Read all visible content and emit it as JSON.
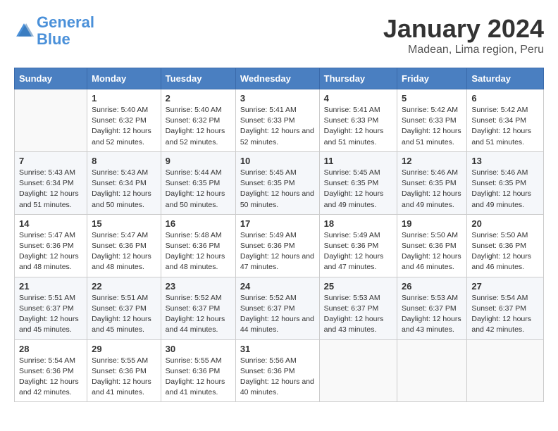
{
  "header": {
    "logo_line1": "General",
    "logo_line2": "Blue",
    "month": "January 2024",
    "location": "Madean, Lima region, Peru"
  },
  "columns": [
    "Sunday",
    "Monday",
    "Tuesday",
    "Wednesday",
    "Thursday",
    "Friday",
    "Saturday"
  ],
  "weeks": [
    [
      {
        "day": "",
        "sunrise": "",
        "sunset": "",
        "daylight": ""
      },
      {
        "day": "1",
        "sunrise": "Sunrise: 5:40 AM",
        "sunset": "Sunset: 6:32 PM",
        "daylight": "Daylight: 12 hours and 52 minutes."
      },
      {
        "day": "2",
        "sunrise": "Sunrise: 5:40 AM",
        "sunset": "Sunset: 6:32 PM",
        "daylight": "Daylight: 12 hours and 52 minutes."
      },
      {
        "day": "3",
        "sunrise": "Sunrise: 5:41 AM",
        "sunset": "Sunset: 6:33 PM",
        "daylight": "Daylight: 12 hours and 52 minutes."
      },
      {
        "day": "4",
        "sunrise": "Sunrise: 5:41 AM",
        "sunset": "Sunset: 6:33 PM",
        "daylight": "Daylight: 12 hours and 51 minutes."
      },
      {
        "day": "5",
        "sunrise": "Sunrise: 5:42 AM",
        "sunset": "Sunset: 6:33 PM",
        "daylight": "Daylight: 12 hours and 51 minutes."
      },
      {
        "day": "6",
        "sunrise": "Sunrise: 5:42 AM",
        "sunset": "Sunset: 6:34 PM",
        "daylight": "Daylight: 12 hours and 51 minutes."
      }
    ],
    [
      {
        "day": "7",
        "sunrise": "Sunrise: 5:43 AM",
        "sunset": "Sunset: 6:34 PM",
        "daylight": "Daylight: 12 hours and 51 minutes."
      },
      {
        "day": "8",
        "sunrise": "Sunrise: 5:43 AM",
        "sunset": "Sunset: 6:34 PM",
        "daylight": "Daylight: 12 hours and 50 minutes."
      },
      {
        "day": "9",
        "sunrise": "Sunrise: 5:44 AM",
        "sunset": "Sunset: 6:35 PM",
        "daylight": "Daylight: 12 hours and 50 minutes."
      },
      {
        "day": "10",
        "sunrise": "Sunrise: 5:45 AM",
        "sunset": "Sunset: 6:35 PM",
        "daylight": "Daylight: 12 hours and 50 minutes."
      },
      {
        "day": "11",
        "sunrise": "Sunrise: 5:45 AM",
        "sunset": "Sunset: 6:35 PM",
        "daylight": "Daylight: 12 hours and 49 minutes."
      },
      {
        "day": "12",
        "sunrise": "Sunrise: 5:46 AM",
        "sunset": "Sunset: 6:35 PM",
        "daylight": "Daylight: 12 hours and 49 minutes."
      },
      {
        "day": "13",
        "sunrise": "Sunrise: 5:46 AM",
        "sunset": "Sunset: 6:35 PM",
        "daylight": "Daylight: 12 hours and 49 minutes."
      }
    ],
    [
      {
        "day": "14",
        "sunrise": "Sunrise: 5:47 AM",
        "sunset": "Sunset: 6:36 PM",
        "daylight": "Daylight: 12 hours and 48 minutes."
      },
      {
        "day": "15",
        "sunrise": "Sunrise: 5:47 AM",
        "sunset": "Sunset: 6:36 PM",
        "daylight": "Daylight: 12 hours and 48 minutes."
      },
      {
        "day": "16",
        "sunrise": "Sunrise: 5:48 AM",
        "sunset": "Sunset: 6:36 PM",
        "daylight": "Daylight: 12 hours and 48 minutes."
      },
      {
        "day": "17",
        "sunrise": "Sunrise: 5:49 AM",
        "sunset": "Sunset: 6:36 PM",
        "daylight": "Daylight: 12 hours and 47 minutes."
      },
      {
        "day": "18",
        "sunrise": "Sunrise: 5:49 AM",
        "sunset": "Sunset: 6:36 PM",
        "daylight": "Daylight: 12 hours and 47 minutes."
      },
      {
        "day": "19",
        "sunrise": "Sunrise: 5:50 AM",
        "sunset": "Sunset: 6:36 PM",
        "daylight": "Daylight: 12 hours and 46 minutes."
      },
      {
        "day": "20",
        "sunrise": "Sunrise: 5:50 AM",
        "sunset": "Sunset: 6:36 PM",
        "daylight": "Daylight: 12 hours and 46 minutes."
      }
    ],
    [
      {
        "day": "21",
        "sunrise": "Sunrise: 5:51 AM",
        "sunset": "Sunset: 6:37 PM",
        "daylight": "Daylight: 12 hours and 45 minutes."
      },
      {
        "day": "22",
        "sunrise": "Sunrise: 5:51 AM",
        "sunset": "Sunset: 6:37 PM",
        "daylight": "Daylight: 12 hours and 45 minutes."
      },
      {
        "day": "23",
        "sunrise": "Sunrise: 5:52 AM",
        "sunset": "Sunset: 6:37 PM",
        "daylight": "Daylight: 12 hours and 44 minutes."
      },
      {
        "day": "24",
        "sunrise": "Sunrise: 5:52 AM",
        "sunset": "Sunset: 6:37 PM",
        "daylight": "Daylight: 12 hours and 44 minutes."
      },
      {
        "day": "25",
        "sunrise": "Sunrise: 5:53 AM",
        "sunset": "Sunset: 6:37 PM",
        "daylight": "Daylight: 12 hours and 43 minutes."
      },
      {
        "day": "26",
        "sunrise": "Sunrise: 5:53 AM",
        "sunset": "Sunset: 6:37 PM",
        "daylight": "Daylight: 12 hours and 43 minutes."
      },
      {
        "day": "27",
        "sunrise": "Sunrise: 5:54 AM",
        "sunset": "Sunset: 6:37 PM",
        "daylight": "Daylight: 12 hours and 42 minutes."
      }
    ],
    [
      {
        "day": "28",
        "sunrise": "Sunrise: 5:54 AM",
        "sunset": "Sunset: 6:36 PM",
        "daylight": "Daylight: 12 hours and 42 minutes."
      },
      {
        "day": "29",
        "sunrise": "Sunrise: 5:55 AM",
        "sunset": "Sunset: 6:36 PM",
        "daylight": "Daylight: 12 hours and 41 minutes."
      },
      {
        "day": "30",
        "sunrise": "Sunrise: 5:55 AM",
        "sunset": "Sunset: 6:36 PM",
        "daylight": "Daylight: 12 hours and 41 minutes."
      },
      {
        "day": "31",
        "sunrise": "Sunrise: 5:56 AM",
        "sunset": "Sunset: 6:36 PM",
        "daylight": "Daylight: 12 hours and 40 minutes."
      },
      {
        "day": "",
        "sunrise": "",
        "sunset": "",
        "daylight": ""
      },
      {
        "day": "",
        "sunrise": "",
        "sunset": "",
        "daylight": ""
      },
      {
        "day": "",
        "sunrise": "",
        "sunset": "",
        "daylight": ""
      }
    ]
  ]
}
